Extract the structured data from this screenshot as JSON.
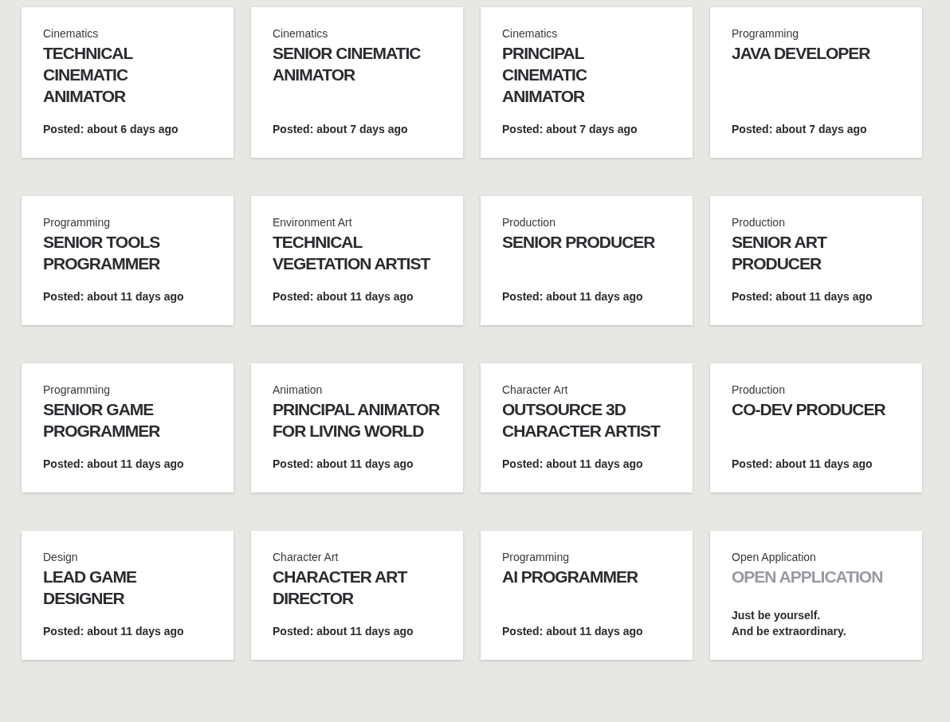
{
  "cards": [
    {
      "kind": "job",
      "category": "Cinematics",
      "title": "TECHNICAL CINEMATIC ANIMATOR",
      "footer_lines": [
        "Posted: about 6 days ago"
      ]
    },
    {
      "kind": "job",
      "category": "Cinematics",
      "title": "SENIOR CINEMATIC ANIMATOR",
      "footer_lines": [
        "Posted: about 7 days ago"
      ]
    },
    {
      "kind": "job",
      "category": "Cinematics",
      "title": "PRINCIPAL CINEMATIC ANIMATOR",
      "footer_lines": [
        "Posted: about 7 days ago"
      ]
    },
    {
      "kind": "job",
      "category": "Programming",
      "title": "JAVA DEVELOPER",
      "footer_lines": [
        "Posted: about 7 days ago"
      ]
    },
    {
      "kind": "job",
      "category": "Programming",
      "title": "SENIOR TOOLS PROGRAMMER",
      "footer_lines": [
        "Posted: about 11 days ago"
      ]
    },
    {
      "kind": "job",
      "category": "Environment Art",
      "title": "TECHNICAL VEGETATION ARTIST",
      "footer_lines": [
        "Posted: about 11 days ago"
      ]
    },
    {
      "kind": "job",
      "category": "Production",
      "title": "SENIOR PRODUCER",
      "footer_lines": [
        "Posted: about 11 days ago"
      ]
    },
    {
      "kind": "job",
      "category": "Production",
      "title": "SENIOR ART PRODUCER",
      "footer_lines": [
        "Posted: about 11 days ago"
      ]
    },
    {
      "kind": "job",
      "category": "Programming",
      "title": "SENIOR GAME PROGRAMMER",
      "footer_lines": [
        "Posted: about 11 days ago"
      ]
    },
    {
      "kind": "job",
      "category": "Animation",
      "title": "PRINCIPAL ANIMATOR FOR LIVING WORLD",
      "footer_lines": [
        "Posted: about 11 days ago"
      ]
    },
    {
      "kind": "job",
      "category": "Character Art",
      "title": "OUTSOURCE 3D CHARACTER ARTIST",
      "footer_lines": [
        "Posted: about 11 days ago"
      ]
    },
    {
      "kind": "job",
      "category": "Production",
      "title": "CO-DEV PRODUCER",
      "footer_lines": [
        "Posted: about 11 days ago"
      ]
    },
    {
      "kind": "job",
      "category": "Design",
      "title": "LEAD GAME DESIGNER",
      "footer_lines": [
        "Posted: about 11 days ago"
      ]
    },
    {
      "kind": "job",
      "category": "Character Art",
      "title": "CHARACTER ART DIRECTOR",
      "footer_lines": [
        "Posted: about 11 days ago"
      ]
    },
    {
      "kind": "job",
      "category": "Programming",
      "title": "AI PROGRAMMER",
      "footer_lines": [
        "Posted: about 11 days ago"
      ]
    },
    {
      "kind": "open",
      "category": "Open Application",
      "title": "OPEN APPLICATION",
      "footer_lines": [
        "Just be yourself.",
        "And be extraordinary."
      ]
    }
  ]
}
